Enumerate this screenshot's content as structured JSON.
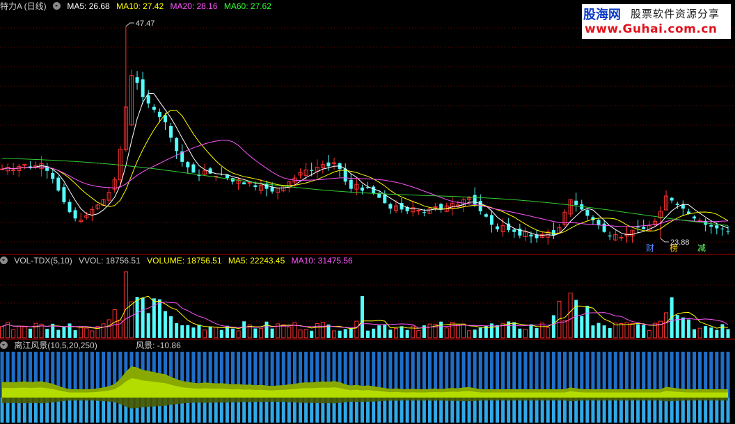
{
  "header": {
    "title": "特力A (日线)",
    "ma": [
      {
        "label": "MA5: 26.68",
        "color": "#ffffff"
      },
      {
        "label": "MA10: 27.42",
        "color": "#ffff00"
      },
      {
        "label": "MA20: 28.16",
        "color": "#ff55ff"
      },
      {
        "label": "MA60: 27.62",
        "color": "#33ff33"
      }
    ]
  },
  "logo": {
    "main": "股海网",
    "sub": "股票软件资源分享",
    "url": "www.Guhai.com.cn"
  },
  "events": [
    {
      "label": "财",
      "color": "#5588ff"
    },
    {
      "label": "榜",
      "color": "#ffcc00"
    },
    {
      "label": "减",
      "color": "#66ff66"
    }
  ],
  "volume_header": {
    "name": "VOL-TDX(5,10)",
    "vvol": "VVOL: 18756.51",
    "volume": "VOLUME: 18756.51",
    "ma5": "MA5: 22243.45",
    "ma10": "MA10: 31475.56"
  },
  "indicator_header": {
    "name": "离江风景(10,5,20,250)",
    "value": "风景: -10.86"
  },
  "colors": {
    "up": "#ff3232",
    "down": "#54fcfc",
    "ma5": "#ffffff",
    "ma10": "#ffff00",
    "ma20": "#ff55ff",
    "ma60": "#33cc33",
    "grid": "#7a0000",
    "bar_top": "#1e6ec8",
    "bar_bottom": "#2fa8e8",
    "band_light": "#bbe600",
    "band_dark": "#556b00"
  },
  "chart_data": [
    {
      "type": "candlestick",
      "title": "特力A (日线)",
      "annotations": [
        "47.47",
        "23.88"
      ],
      "high": 47.47,
      "low": 23.88,
      "close_series": [
        31.6,
        31.8,
        31.5,
        31.9,
        32.1,
        31.7,
        32.0,
        32.2,
        31.4,
        30.5,
        29.2,
        27.9,
        26.8,
        26.1,
        25.9,
        26.4,
        27.1,
        27.6,
        28.2,
        29.0,
        30.4,
        33.8,
        38.5,
        42.0,
        41.2,
        39.6,
        38.9,
        38.2,
        37.4,
        36.8,
        35.1,
        33.6,
        32.4,
        31.8,
        31.2,
        30.9,
        31.4,
        31.1,
        30.8,
        31.0,
        30.6,
        30.2,
        30.4,
        29.9,
        30.1,
        29.6,
        29.8,
        29.4,
        29.1,
        29.5,
        29.7,
        30.2,
        30.6,
        31.2,
        31.5,
        31.4,
        31.8,
        32.1,
        31.9,
        32.3,
        31.6,
        30.2,
        29.4,
        29.9,
        29.2,
        29.5,
        28.9,
        28.4,
        27.8,
        27.2,
        27.5,
        27.1,
        26.9,
        27.3,
        27.0,
        26.8,
        27.2,
        27.4,
        27.1,
        27.5,
        27.8,
        27.6,
        28.2,
        28.4,
        27.7,
        26.9,
        26.3,
        25.4,
        24.9,
        25.3,
        24.8,
        24.6,
        24.2,
        24.6,
        24.1,
        23.9,
        24.3,
        24.6,
        24.2,
        25.1,
        26.8,
        28.2,
        27.6,
        27.1,
        26.4,
        25.9,
        25.4,
        24.6,
        24.1,
        24.3,
        24.0,
        24.4,
        24.8,
        25.1,
        24.9,
        25.3,
        25.8,
        26.9,
        28.6,
        28.1,
        27.6,
        27.2,
        26.6,
        26.1,
        25.9,
        25.4,
        25.2,
        25.0,
        24.9,
        24.7
      ]
    },
    {
      "type": "bar",
      "title": "VOL-TDX(5,10)",
      "ma5": 22243.45,
      "ma10": 31475.56,
      "last_volume": 18756.51
    },
    {
      "type": "area",
      "title": "离江风景(10,5,20,250)",
      "last_value": -10.86
    }
  ]
}
